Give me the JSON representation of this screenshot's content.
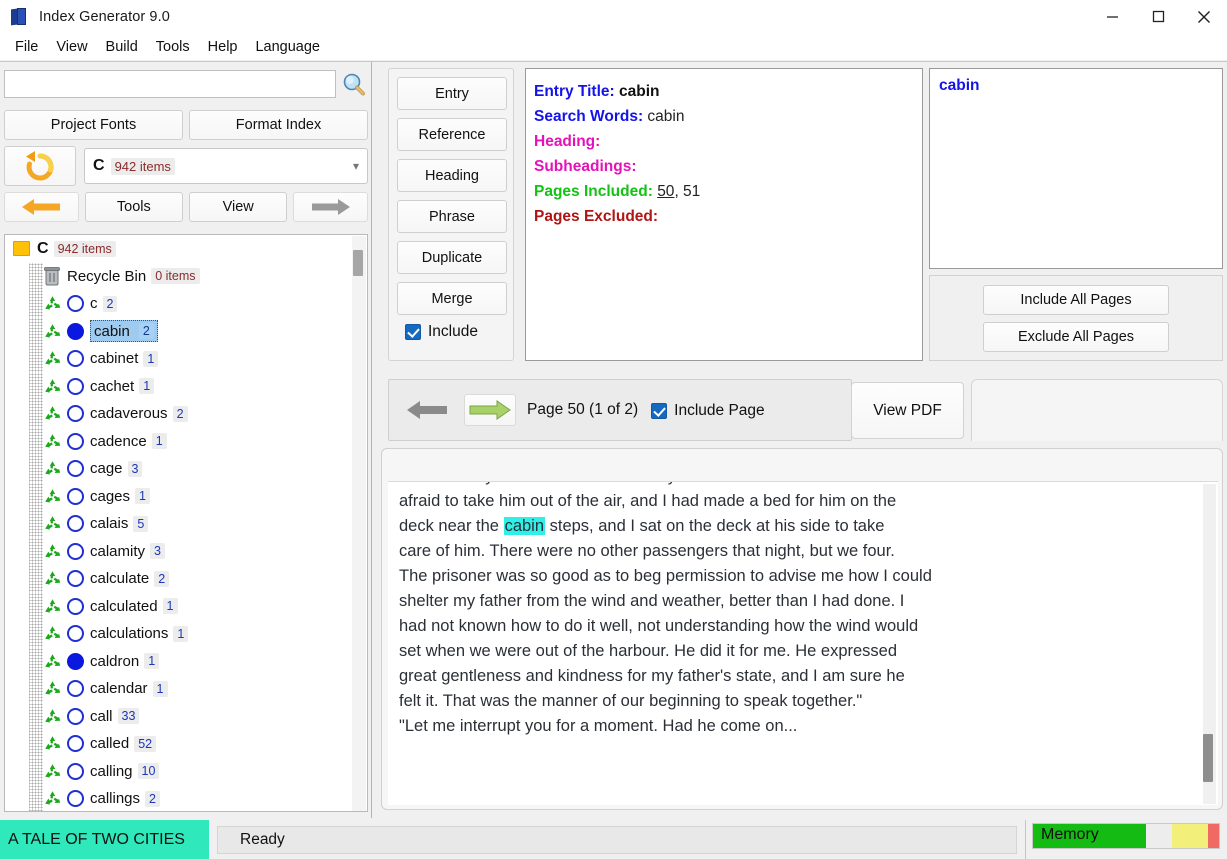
{
  "window": {
    "title": "Index Generator 9.0",
    "icon": "book-icon",
    "controls": [
      {
        "name": "minimize-button",
        "glyph": "minimize-icon"
      },
      {
        "name": "maximize-button",
        "glyph": "maximize-icon"
      },
      {
        "name": "close-button",
        "glyph": "close-icon"
      }
    ]
  },
  "menu": {
    "items": [
      "File",
      "View",
      "Build",
      "Tools",
      "Help",
      "Language"
    ]
  },
  "left_pane": {
    "search": {
      "value": "",
      "placeholder": "",
      "icon": "magnifier-icon"
    },
    "buttons": {
      "project_fonts": "Project Fonts",
      "format_index": "Format Index",
      "tools": "Tools",
      "view": "View",
      "refresh_icon": "refresh-icon",
      "back_icon": "arrow-left-icon",
      "forward_icon": "arrow-right-icon"
    },
    "combo": {
      "letter": "C",
      "count": "942 items",
      "arrow": "chevron-down-icon"
    },
    "tree": {
      "root": {
        "label": "C",
        "count": "942 items",
        "icon": "folder-icon"
      },
      "recycle_bin": {
        "label": "Recycle Bin",
        "count": "0 items",
        "icon": "recycle-bin-icon"
      },
      "items": [
        {
          "label": "c",
          "count": "2",
          "filled": false
        },
        {
          "label": "cabin",
          "count": "2",
          "filled": true,
          "selected": true
        },
        {
          "label": "cabinet",
          "count": "1",
          "filled": false
        },
        {
          "label": "cachet",
          "count": "1",
          "filled": false
        },
        {
          "label": "cadaverous",
          "count": "2",
          "filled": false
        },
        {
          "label": "cadence",
          "count": "1",
          "filled": false
        },
        {
          "label": "cage",
          "count": "3",
          "filled": false
        },
        {
          "label": "cages",
          "count": "1",
          "filled": false
        },
        {
          "label": "calais",
          "count": "5",
          "filled": false
        },
        {
          "label": "calamity",
          "count": "3",
          "filled": false
        },
        {
          "label": "calculate",
          "count": "2",
          "filled": false
        },
        {
          "label": "calculated",
          "count": "1",
          "filled": false
        },
        {
          "label": "calculations",
          "count": "1",
          "filled": false
        },
        {
          "label": "caldron",
          "count": "1",
          "filled": true
        },
        {
          "label": "calendar",
          "count": "1",
          "filled": false
        },
        {
          "label": "call",
          "count": "33",
          "filled": false
        },
        {
          "label": "called",
          "count": "52",
          "filled": false
        },
        {
          "label": "calling",
          "count": "10",
          "filled": false
        },
        {
          "label": "callings",
          "count": "2",
          "filled": false
        }
      ]
    }
  },
  "center_buttons": {
    "items": [
      "Entry",
      "Reference",
      "Heading",
      "Phrase",
      "Duplicate",
      "Merge"
    ],
    "include": {
      "label": "Include",
      "checked": true
    }
  },
  "entry_info": {
    "title_label": "Entry Title:",
    "title_value": "cabin",
    "search_words_label": "Search Words:",
    "search_words_value": "cabin",
    "heading_label": "Heading:",
    "heading_value": "",
    "subheadings_label": "Subheadings:",
    "subheadings_value": "",
    "pages_included_label": "Pages Included:",
    "pages_included_first": "50",
    "pages_included_rest": ", 51",
    "pages_excluded_label": "Pages Excluded:",
    "pages_excluded_value": "",
    "colors": {
      "label_blue": "#1414e8",
      "label_magenta": "#e512b9",
      "label_green": "#13c213",
      "label_red": "#b01414"
    }
  },
  "right_panel": {
    "entry_text": "cabin",
    "include_all": "Include All Pages",
    "exclude_all": "Exclude All Pages"
  },
  "page_nav": {
    "prev_icon": "arrow-left-icon",
    "next_icon": "arrow-right-icon",
    "page_label": "Page 50 (1 of 2)",
    "include_page": {
      "label": "Include Page",
      "checked": true
    },
    "view_pdf": "View PDF"
  },
  "text_view": {
    "highlight_word": "cabin",
    "highlight_color": "#2ff0e8",
    "lines": [
      {
        "pre": "and in a very weak state of health. My father was so reduced that I was",
        "hl": "",
        "post": ""
      },
      {
        "pre": "afraid to take him out of the air, and I had made a bed for him on the",
        "hl": "",
        "post": ""
      },
      {
        "pre": "deck near the ",
        "hl": "cabin",
        "post": " steps, and I sat on the deck at his side to take"
      },
      {
        "pre": "care of him. There were no other passengers that night, but we four.",
        "hl": "",
        "post": ""
      },
      {
        "pre": "The prisoner was so good as to beg permission to advise me how I could",
        "hl": "",
        "post": ""
      },
      {
        "pre": "shelter my father from the wind and weather, better than I had done. I",
        "hl": "",
        "post": ""
      },
      {
        "pre": "had not known how to do it well, not understanding how the wind would",
        "hl": "",
        "post": ""
      },
      {
        "pre": "set when we were out of the harbour. He did it for me. He expressed",
        "hl": "",
        "post": ""
      },
      {
        "pre": "great gentleness and kindness for my father's state, and I am sure he",
        "hl": "",
        "post": ""
      },
      {
        "pre": "felt it. That was the manner of our beginning to speak together.\"",
        "hl": "",
        "post": ""
      },
      {
        "pre": "\"Let me interrupt you for a moment. Had he come on...",
        "hl": "",
        "post": ""
      }
    ]
  },
  "status_bar": {
    "book_title": "A TALE OF TWO CITIES",
    "message": "Ready",
    "memory_label": "Memory"
  }
}
